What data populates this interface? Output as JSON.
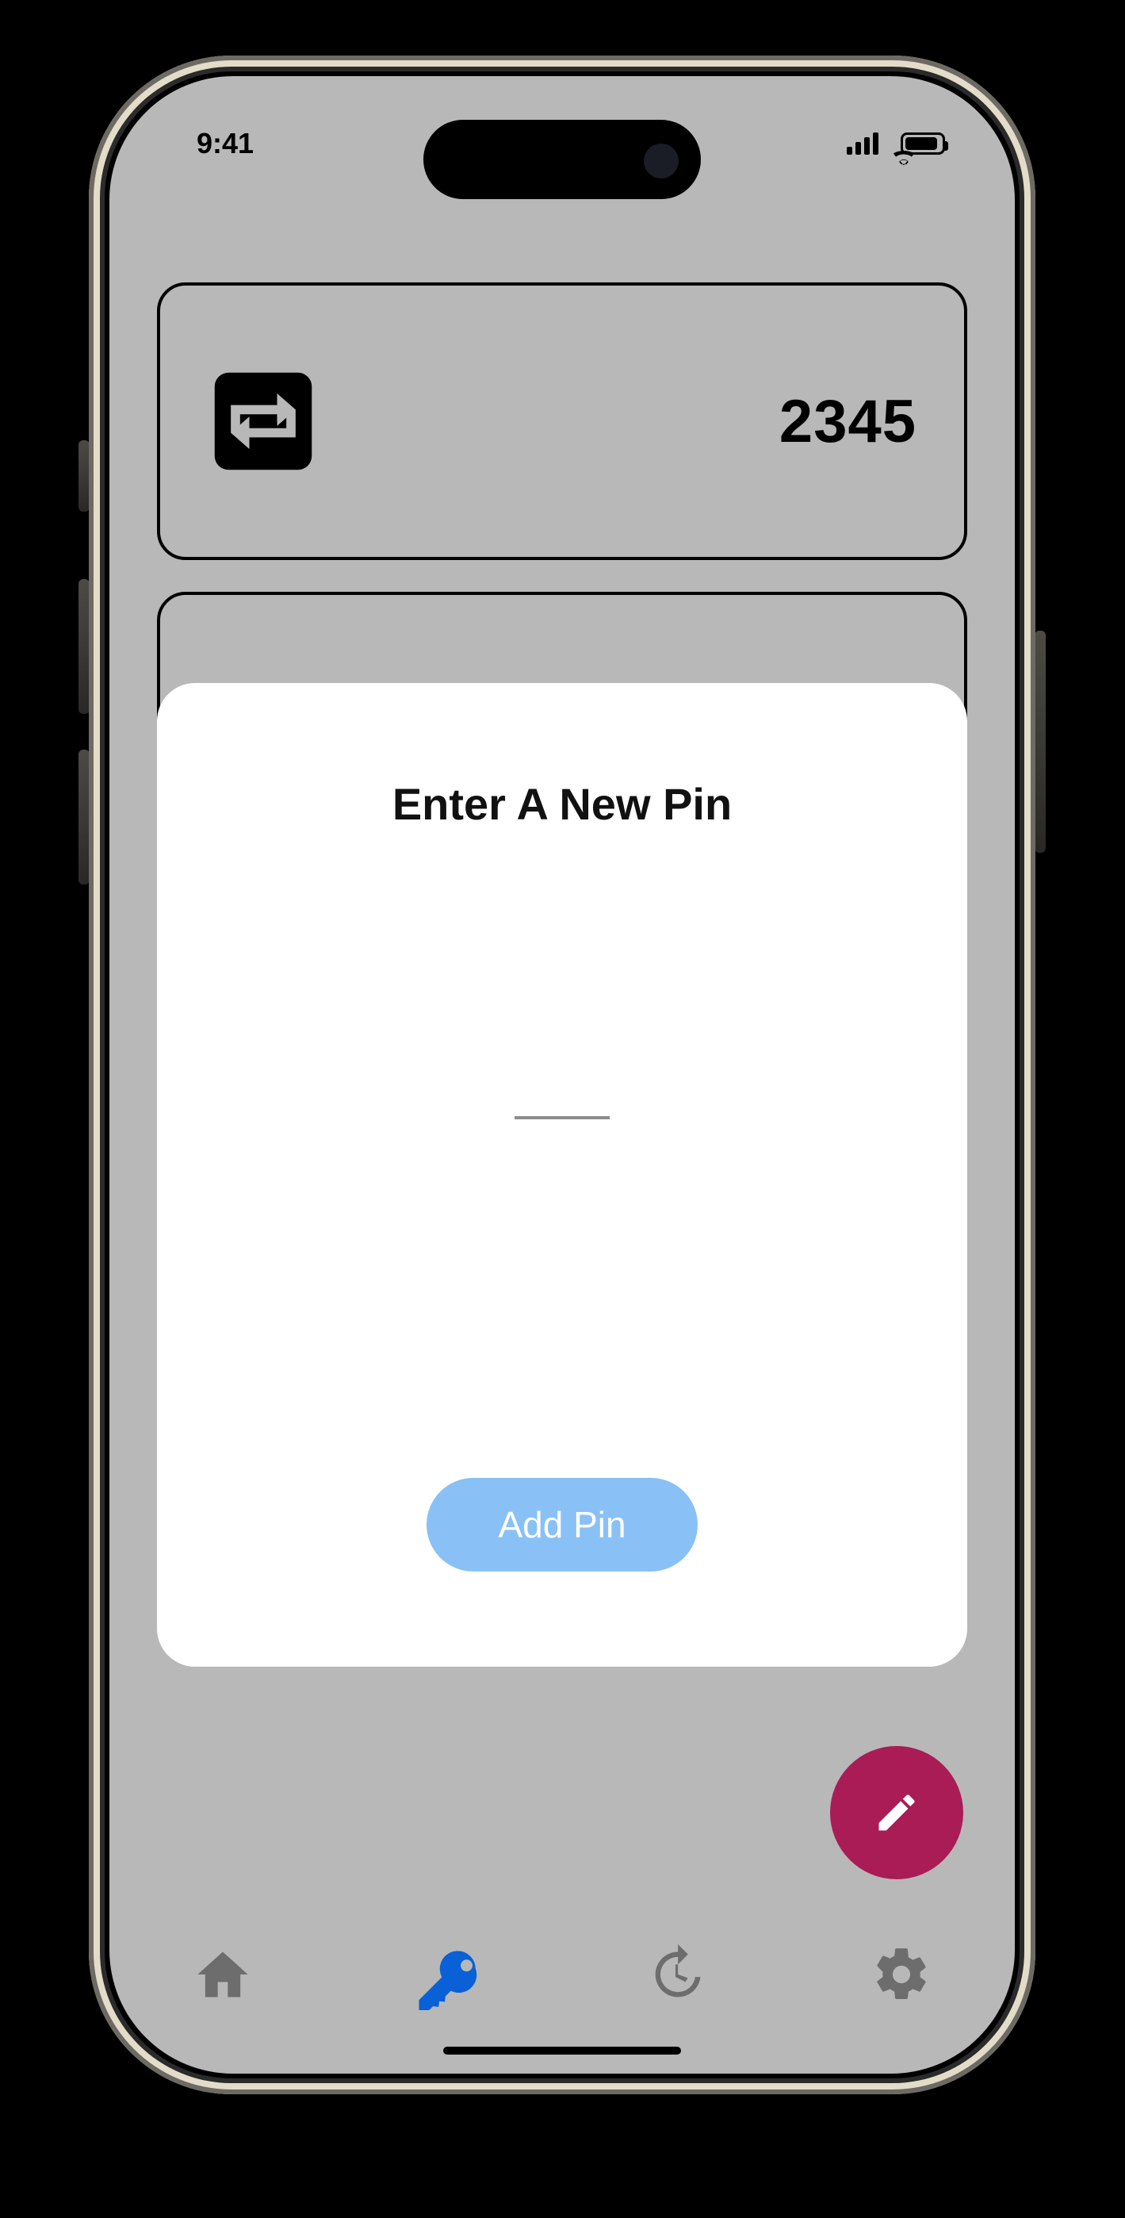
{
  "status": {
    "time": "9:41"
  },
  "cards": [
    {
      "value": "2345"
    }
  ],
  "dialog": {
    "title": "Enter A New Pin",
    "pin_value": "",
    "add_label": "Add Pin"
  },
  "tabs": {
    "home": "home",
    "key": "key",
    "history": "history",
    "settings": "settings",
    "active": "key"
  },
  "fab": {
    "icon": "edit"
  },
  "colors": {
    "accent_blue": "#0a60d6",
    "light_blue": "#89c1f6",
    "maroon": "#a91c56",
    "bg_grey": "#b8b8b8"
  }
}
